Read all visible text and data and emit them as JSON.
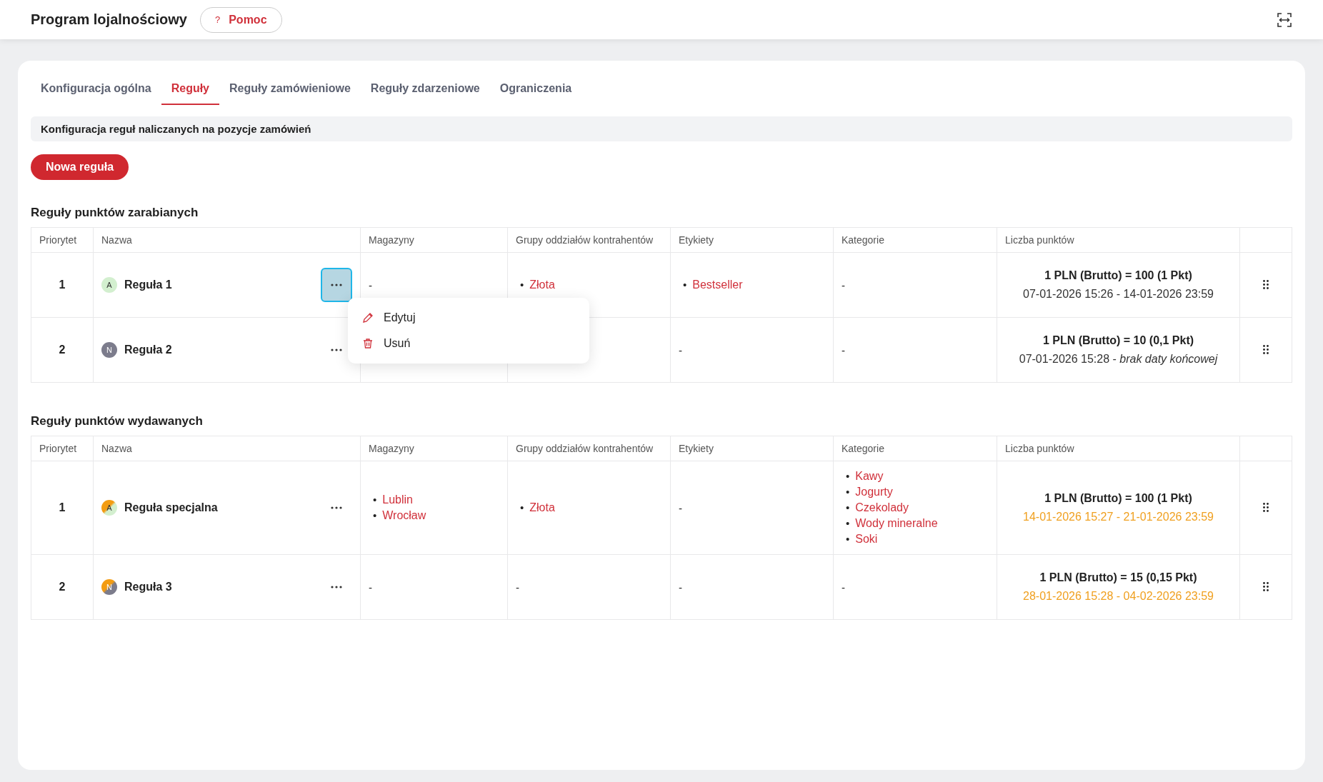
{
  "header": {
    "title": "Program lojalnościowy",
    "help_icon": "?",
    "help_label": "Pomoc"
  },
  "tabs": [
    {
      "label": "Konfiguracja ogólna",
      "selected": false
    },
    {
      "label": "Reguły",
      "selected": true
    },
    {
      "label": "Reguły zamówieniowe",
      "selected": false
    },
    {
      "label": "Reguły zdarzeniowe",
      "selected": false
    },
    {
      "label": "Ograniczenia",
      "selected": false
    }
  ],
  "info": "Konfiguracja reguł naliczanych na pozycje zamówień",
  "new_button": "Nowa reguła",
  "sections": [
    {
      "title": "Reguły punktów zarabianych",
      "columns": [
        "Priorytet",
        "Nazwa",
        "Magazyny",
        "Grupy oddziałów kontrahentów",
        "Etykiety",
        "Kategorie",
        "Liczba punktów"
      ],
      "rows": [
        {
          "priority": "1",
          "letter": "A",
          "color": "#d3efcf",
          "scheduled": false,
          "name": "Reguła 1",
          "menu_open": true,
          "warehouses": "-",
          "groups": [
            {
              "marker": "•",
              "text": "Złota"
            }
          ],
          "labels": [
            {
              "marker": "•",
              "text": "Bestseller"
            }
          ],
          "categories": "-",
          "points": "1 PLN (Brutto) = 100 (1 Pkt)",
          "dates": "07-01-2026 15:26 - 14-01-2026 23:59"
        },
        {
          "priority": "2",
          "letter": "N",
          "color": "#7c7c8c",
          "scheduled": false,
          "name": "Reguła 2",
          "menu_open": false,
          "labels": "-",
          "categories": "-",
          "points": "1 PLN (Brutto) = 10 (0,1 Pkt)",
          "dates": "07-01-2026 15:28 - *brak daty końcowej*"
        }
      ]
    },
    {
      "title": "Reguły punktów wydawanych",
      "columns": [
        "Priorytet",
        "Nazwa",
        "Magazyny",
        "Grupy oddziałów kontrahentów",
        "Etykiety",
        "Kategorie",
        "Liczba punktów"
      ],
      "rows": [
        {
          "priority": "1",
          "letter": "A",
          "color": "#d3efcf",
          "scheduled": true,
          "name": "Reguła specjalna",
          "menu_open": false,
          "warehouses": [
            {
              "marker": "•",
              "text": "Lublin"
            },
            {
              "marker": "•",
              "text": "Wrocław"
            }
          ],
          "groups": [
            {
              "marker": "•",
              "text": "Złota"
            }
          ],
          "labels": "-",
          "categories": [
            {
              "marker": "•",
              "text": "Kawy"
            },
            {
              "marker": "•",
              "text": "Jogurty"
            },
            {
              "marker": "•",
              "text": "Czekolady"
            },
            {
              "marker": "•",
              "text": "Wody mineralne"
            },
            {
              "marker": "•",
              "text": "Soki"
            }
          ],
          "points": "1 PLN (Brutto) = 100 (1 Pkt)",
          "dates": "14-01-2026 15:27 - 21-01-2026 23:59"
        },
        {
          "priority": "2",
          "letter": "N",
          "color": "#7c7c8c",
          "scheduled": true,
          "name": "Reguła 3",
          "menu_open": false,
          "warehouses": "-",
          "groups": "-",
          "labels": "-",
          "categories": "-",
          "points": "1 PLN (Brutto) = 15 (0,15 Pkt)",
          "dates": "28-01-2026 15:28 - 04-02-2026 23:59"
        }
      ]
    }
  ],
  "row_menu": [
    {
      "kind": "edit",
      "label": "Edytuj"
    },
    {
      "kind": "delete",
      "label": "Usuń"
    }
  ]
}
